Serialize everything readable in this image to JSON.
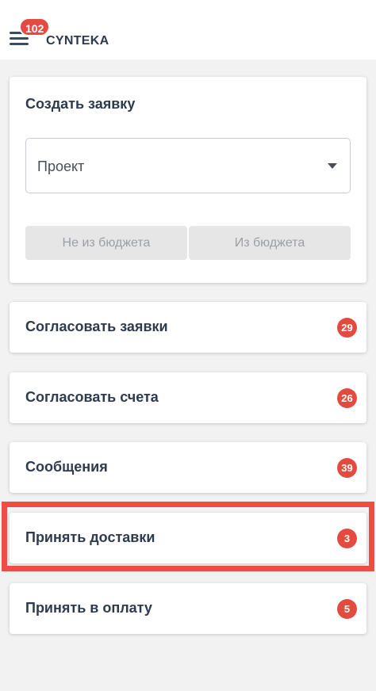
{
  "header": {
    "notification_count": "102",
    "app_title": "CYNTEKA"
  },
  "create_request": {
    "title": "Создать заявку",
    "project_placeholder": "Проект",
    "not_from_budget_label": "Не из бюджета",
    "from_budget_label": "Из бюджета"
  },
  "menu_items": [
    {
      "label": "Согласовать заявки",
      "count": "29"
    },
    {
      "label": "Согласовать счета",
      "count": "26"
    },
    {
      "label": "Сообщения",
      "count": "39"
    },
    {
      "label": "Принять доставки",
      "count": "3"
    },
    {
      "label": "Принять в оплату",
      "count": "5"
    }
  ],
  "colors": {
    "badge": "#e44b40",
    "highlight": "#ea4f42",
    "text": "#2e3a4e"
  }
}
